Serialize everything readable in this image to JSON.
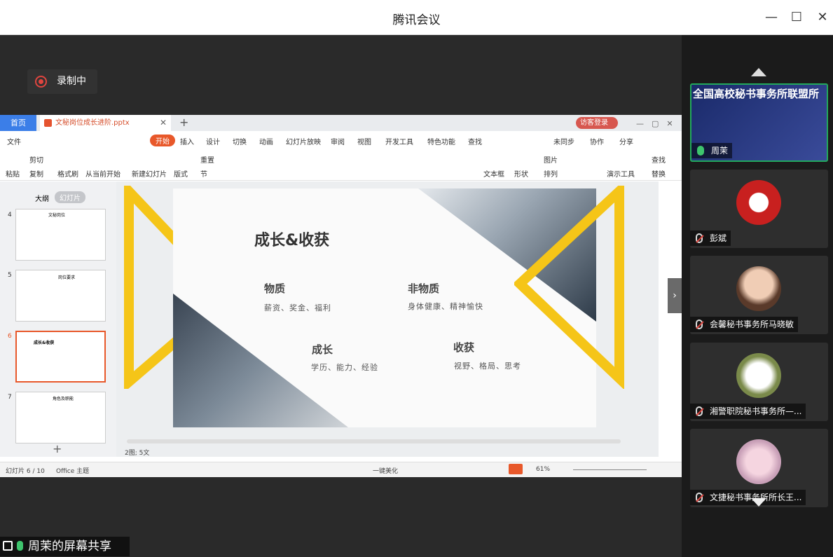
{
  "window": {
    "title": "腾讯会议"
  },
  "recording": {
    "label": "录制中"
  },
  "wps": {
    "tabs": {
      "home": "首页",
      "doc": "文秘岗位成长进阶.pptx",
      "login": "访客登录"
    },
    "menu": [
      "文件",
      "开始",
      "插入",
      "设计",
      "切换",
      "动画",
      "幻灯片放映",
      "审阅",
      "视图",
      "开发工具",
      "特色功能",
      "查找"
    ],
    "menu_right": [
      "未同步",
      "协作",
      "分享"
    ],
    "ribbon": [
      "粘贴",
      "剪切",
      "复制",
      "格式刷",
      "从当前开始",
      "新建幻灯片",
      "版式",
      "节",
      "重置",
      "文本框",
      "形状",
      "图片",
      "排列",
      "演示工具",
      "查找",
      "替换"
    ],
    "panel_tabs": [
      "大纲",
      "幻灯片"
    ],
    "thumbs": [
      {
        "num": "4",
        "title": "文秘岗位"
      },
      {
        "num": "5",
        "title": "岗位要求"
      },
      {
        "num": "6",
        "title": "成长&收获"
      },
      {
        "num": "7",
        "title": "角色及职能"
      }
    ],
    "slide": {
      "title": "成长&收获",
      "items": [
        {
          "head": "物质",
          "sub": "薪资、奖金、福利"
        },
        {
          "head": "非物质",
          "sub": "身体健康、精神愉快"
        },
        {
          "head": "成长",
          "sub": "学历、能力、经验"
        },
        {
          "head": "收获",
          "sub": "视野、格局、思考"
        }
      ]
    },
    "notes": "2图; 5文",
    "status": {
      "slide": "幻灯片 6 / 10",
      "theme": "Office 主题",
      "beautify": "一键美化",
      "zoom": "61%"
    }
  },
  "participants": [
    {
      "name": "周茉",
      "banner": "全国高校秘书事务所联盟所",
      "mic": "on"
    },
    {
      "name": "彭斌",
      "mic": "off"
    },
    {
      "name": "会馨秘书事务所马晓敏",
      "mic": "off"
    },
    {
      "name": "湘警职院秘书事务所—...",
      "mic": "off"
    },
    {
      "name": "文捷秘书事务所所长王...",
      "mic": "off"
    }
  ],
  "share": {
    "label": "周茉的屏幕共享"
  },
  "colors": {
    "accent": "#e8582a",
    "mic_on": "#3ec46d",
    "record": "#e0453f",
    "slide_yellow": "#f5c518"
  }
}
